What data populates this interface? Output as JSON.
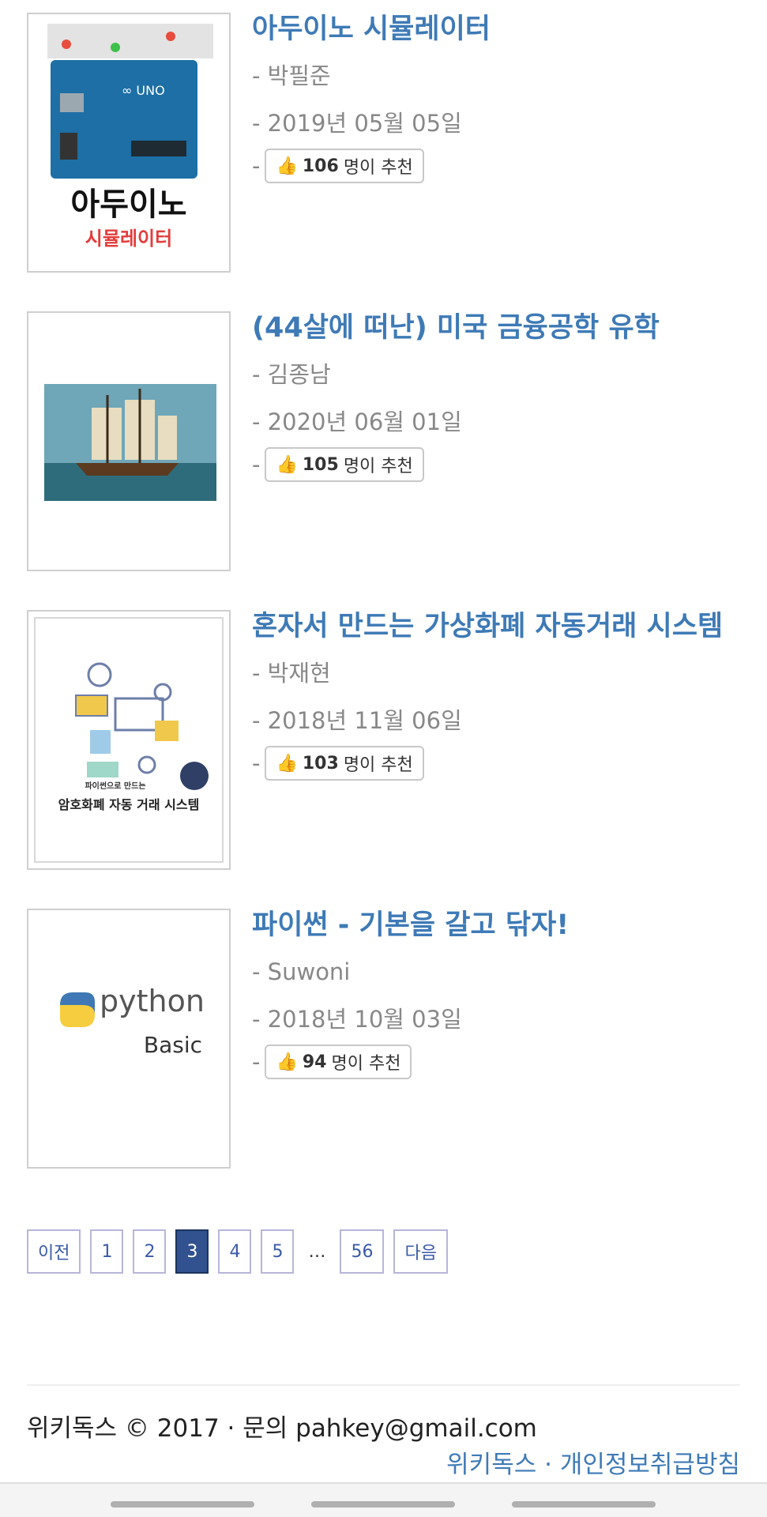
{
  "books": [
    {
      "title": "아두이노 시뮬레이터",
      "author": "- 박필준",
      "date": "- 2019년 05월 05일",
      "dash": "-",
      "count": "106",
      "rec_suffix": "명이 추천",
      "cover_big": "아두이노",
      "cover_sub": "시뮬레이터"
    },
    {
      "title": "(44살에 떠난) 미국 금융공학 유학",
      "author": "- 김종남",
      "date": "- 2020년 06월 01일",
      "dash": "-",
      "count": "105",
      "rec_suffix": "명이 추천"
    },
    {
      "title": "혼자서 만드는 가상화폐 자동거래 시스템",
      "author": "- 박재현",
      "date": "- 2018년 11월 06일",
      "dash": "-",
      "count": "103",
      "rec_suffix": "명이 추천",
      "cover_small": "파이썬으로 만드는",
      "cover_big": "암호화폐 자동 거래 시스템"
    },
    {
      "title": "파이썬 - 기본을 갈고 닦자!",
      "author": "- Suwoni",
      "date": "- 2018년 10월 03일",
      "dash": "-",
      "count": "94",
      "rec_suffix": "명이 추천",
      "cover_logo": "python",
      "cover_sub": "Basic"
    }
  ],
  "pagination": {
    "prev": "이전",
    "pages": [
      "1",
      "2",
      "3",
      "4",
      "5"
    ],
    "ellipsis": "…",
    "last": "56",
    "next": "다음",
    "current": "3"
  },
  "footer": {
    "line1": "위키독스 © 2017 · 문의 pahkey@gmail.com",
    "link_wikidocs": "위키독스",
    "sep": "·",
    "link_privacy": "개인정보취급방침"
  },
  "icons": {
    "recommend": "thumbs-up-icon"
  },
  "colors": {
    "title": "#3e7ab6",
    "pager_active": "#31528f",
    "pager_border": "#b6b6d9"
  }
}
